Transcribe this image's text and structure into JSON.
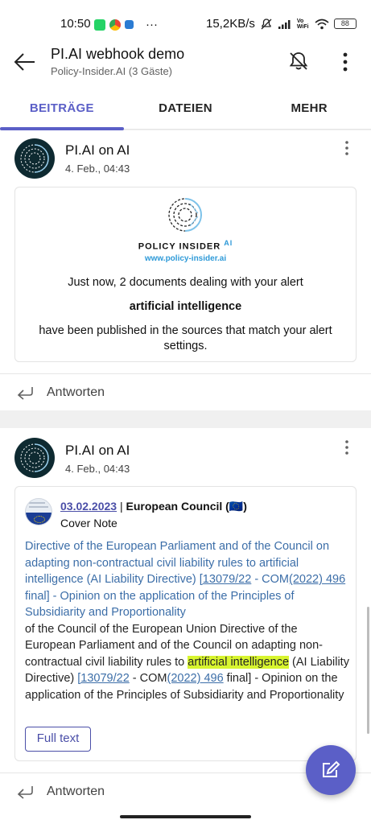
{
  "status_bar": {
    "time": "10:50",
    "dots": "···",
    "speed": "15,2KB/s",
    "battery": "88",
    "wifi_label": "Vo WiFi"
  },
  "header": {
    "title": "PI.AI webhook demo",
    "subtitle": "Policy-Insider.AI (3 Gäste)"
  },
  "tabs": [
    {
      "label": "BEITRÄGE",
      "active": true
    },
    {
      "label": "DATEIEN",
      "active": false
    },
    {
      "label": "MEHR",
      "active": false
    }
  ],
  "posts": [
    {
      "author": "PI.AI on AI",
      "time": "4. Feb., 04:43",
      "logo_name": "POLICY INSIDER",
      "logo_ai": "AI",
      "logo_url": "www.policy-insider.ai",
      "line1": "Just now, 2 documents dealing with your alert",
      "alert": "artificial intelligence",
      "line3a": "have been published in the sources that match your alert",
      "line3b": "settings.",
      "reply_label": "Antworten"
    },
    {
      "author": "PI.AI on AI",
      "time": "4. Feb., 04:43",
      "date": "03.02.2023",
      "separator": " | ",
      "source": "European Council (🇪🇺)",
      "doc_type": "Cover Note",
      "title_part1": "Directive of the European Parliament and of the Council on adapting non-contractual civil liability rules to artificial intelligence (AI Liability Directive) ",
      "ref1": "[13079/22",
      "title_part2": " - COM",
      "ref2": "(2022) 496",
      "title_part3": " final] - Opinion on the application of the Principles of Subsidiarity and Proportionality",
      "body_part1": " of the Council of the European Union Directive of the European Parliament and of the Council on adapting non-contractual civil liability rules to ",
      "body_highlight": "artificial intelligence",
      "body_part2": " (AI Liability Directive) ",
      "body_ref1": "[13079/22",
      "body_part3": " - COM",
      "body_ref2": "(2022) 496",
      "body_part4": " final] - Opinion on the application of the Principles of Subsidiarity and Proportionality",
      "button_label": "Full text",
      "reply_label": "Antworten"
    }
  ],
  "colors": {
    "accent": "#5b5fc7",
    "link": "#3c6ea8",
    "highlight": "#d8f52f"
  }
}
